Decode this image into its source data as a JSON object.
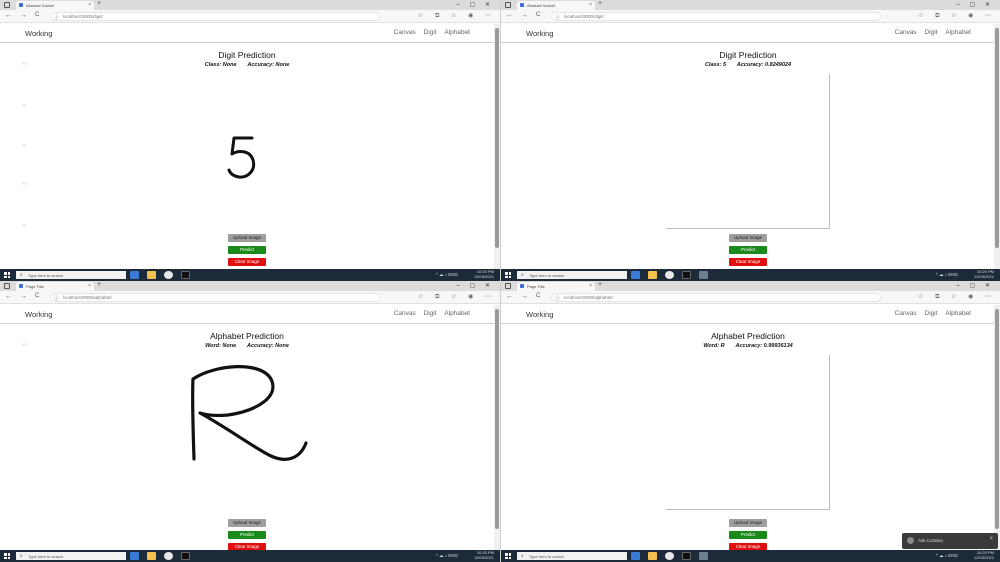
{
  "browser": {
    "new_tab_symbol": "+",
    "close_symbol": "×",
    "window_controls": "–  ▢  ✕",
    "back_symbol": "←",
    "forward_symbol": "→",
    "reload_symbol": "C",
    "url_info_symbol": "ⓘ",
    "tool_icons": "☆ ⧉ ☆ ◉ ⋯"
  },
  "app": {
    "brand": "Working",
    "nav": [
      "Canvas",
      "Digit",
      "Alphabet"
    ],
    "buttons": {
      "upload": "Upload Image",
      "predict": "Predict",
      "clear": "Clear Image"
    }
  },
  "panels": [
    {
      "tab_title": "Abstract Socket",
      "url": "localhost:8000/digit/",
      "heading": "Digit Prediction",
      "result_label_1": "Class:",
      "result_value_1": "None",
      "result_label_2": "Accuracy:",
      "result_value_2": "None",
      "drawing": "5"
    },
    {
      "tab_title": "Abstract Socket",
      "url": "localhost:8000/digit/",
      "heading": "Digit Prediction",
      "result_label_1": "Class:",
      "result_value_1": "5",
      "result_label_2": "Accuracy:",
      "result_value_2": "0.8249024",
      "drawing": ""
    },
    {
      "tab_title": "Page Title",
      "url": "localhost:8000/alphabet/",
      "heading": "Alphabet Prediction",
      "result_label_1": "Word:",
      "result_value_1": "None",
      "result_label_2": "Accuracy:",
      "result_value_2": "None",
      "drawing": "R"
    },
    {
      "tab_title": "Page Title",
      "url": "localhost:8000/alphabet/",
      "heading": "Alphabet Prediction",
      "result_label_1": "Word:",
      "result_value_1": "R",
      "result_label_2": "Accuracy:",
      "result_value_2": "0.99936134",
      "drawing": ""
    }
  ],
  "taskbar": {
    "search_placeholder": "Type here to search",
    "search_icon": "⌕",
    "time": "10:20 PM",
    "date": "12/03/2021",
    "tray": "^ ☁ ♪ ENG"
  },
  "toast": {
    "text": "Ask Cortana",
    "close_symbol": "×"
  },
  "colors": {
    "predict": "#1a8a1a",
    "clear": "#e01010",
    "upload": "#9e9e9e",
    "taskbar": "#1c2a3a"
  }
}
